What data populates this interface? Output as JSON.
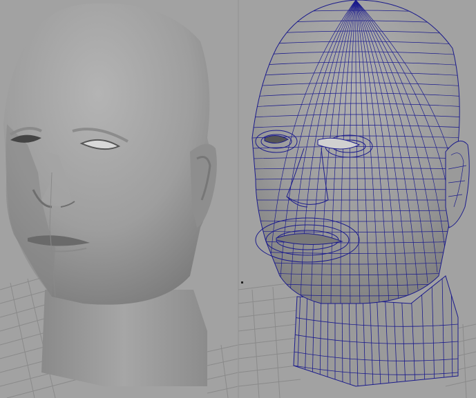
{
  "viewport": {
    "background_color": "#a2a2a2",
    "grid_color": "#8a8a8a",
    "panels": [
      {
        "id": "shaded",
        "display_mode": "smooth-shaded",
        "object": "head-mesh",
        "mesh_color": "#9c9c9c"
      },
      {
        "id": "wireframe",
        "display_mode": "wireframe-on-shaded",
        "object": "head-mesh",
        "mesh_color": "#9a9a9a",
        "wire_color": "#1a1a8c"
      }
    ]
  }
}
